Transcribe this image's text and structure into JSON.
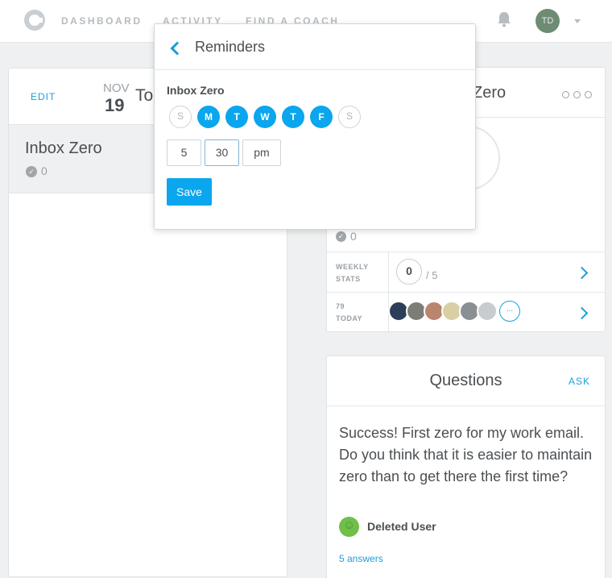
{
  "nav": {
    "items": [
      "DASHBOARD",
      "ACTIVITY",
      "FIND A COACH"
    ],
    "avatar_initials": "TD"
  },
  "left": {
    "edit_label": "EDIT",
    "month": "NOV",
    "day": "19",
    "title_partial": "To",
    "habit": {
      "name": "Inbox Zero",
      "count": "0"
    }
  },
  "right": {
    "title_partial": "Zero",
    "count": "0",
    "weekly": {
      "label_line1": "WEEKLY",
      "label_line2": "STATS",
      "value": "0",
      "goal": "/ 5"
    },
    "today": {
      "count": "79",
      "label": "TODAY",
      "more": "..."
    },
    "avatar_colors": [
      "#2c3e5a",
      "#7d7d78",
      "#b9856e",
      "#d8d0a4",
      "#8a8f93",
      "#c8ccce"
    ]
  },
  "questions": {
    "title": "Questions",
    "ask_label": "ASK",
    "text": "Success! First zero for my work email. Do you think that it is easier to maintain zero than to get there the first time?",
    "user": "Deleted User",
    "answers": "5 answers"
  },
  "popup": {
    "title": "Reminders",
    "habit": "Inbox Zero",
    "days": [
      {
        "label": "S",
        "on": false
      },
      {
        "label": "M",
        "on": true
      },
      {
        "label": "T",
        "on": true
      },
      {
        "label": "W",
        "on": true
      },
      {
        "label": "T",
        "on": true
      },
      {
        "label": "F",
        "on": true
      },
      {
        "label": "S",
        "on": false
      }
    ],
    "hour": "5",
    "minute": "30",
    "ampm": "pm",
    "save_label": "Save"
  },
  "colors": {
    "accent": "#0aa6ee",
    "link": "#1a9fd9"
  }
}
